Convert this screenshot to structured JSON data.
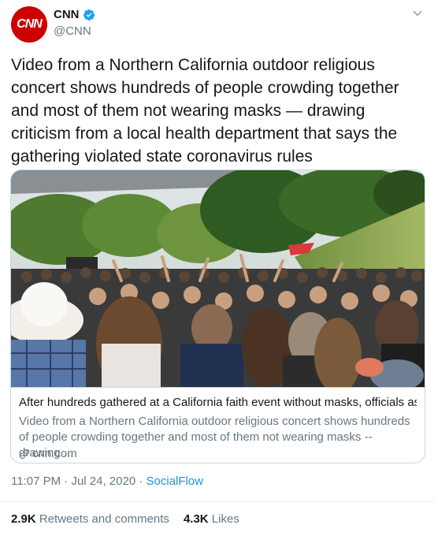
{
  "header": {
    "avatar_text": "CNN",
    "display_name": "CNN",
    "handle": "@CNN",
    "verified_icon": "verified-badge-icon",
    "menu_icon": "chevron-down-icon"
  },
  "tweet": {
    "text": "Video from a Northern California outdoor religious concert shows hundreds of people crowding together and most of them not wearing masks — drawing criticism from a local health department that says the gathering violated state coronavirus rules"
  },
  "card": {
    "image_icon": "concert-crowd-photo",
    "title": "After hundreds gathered at a California faith event without masks, officials ask th...",
    "description": "Video from a Northern California outdoor religious concert shows hundreds of people crowding together and most of them not wearing masks -- drawing ...",
    "domain": "cnn.com",
    "link_icon": "link-icon"
  },
  "meta": {
    "time": "11:07 PM",
    "separator1": " · ",
    "date": "Jul 24, 2020",
    "separator2": " · ",
    "source": "SocialFlow"
  },
  "stats": {
    "retweets_count": "2.9K",
    "retweets_label": "Retweets and comments",
    "likes_count": "4.3K",
    "likes_label": "Likes"
  },
  "colors": {
    "brand_red": "#cc0000",
    "link_blue": "#1b95e0",
    "muted_gray": "#657786",
    "border": "#ccd6dd"
  }
}
